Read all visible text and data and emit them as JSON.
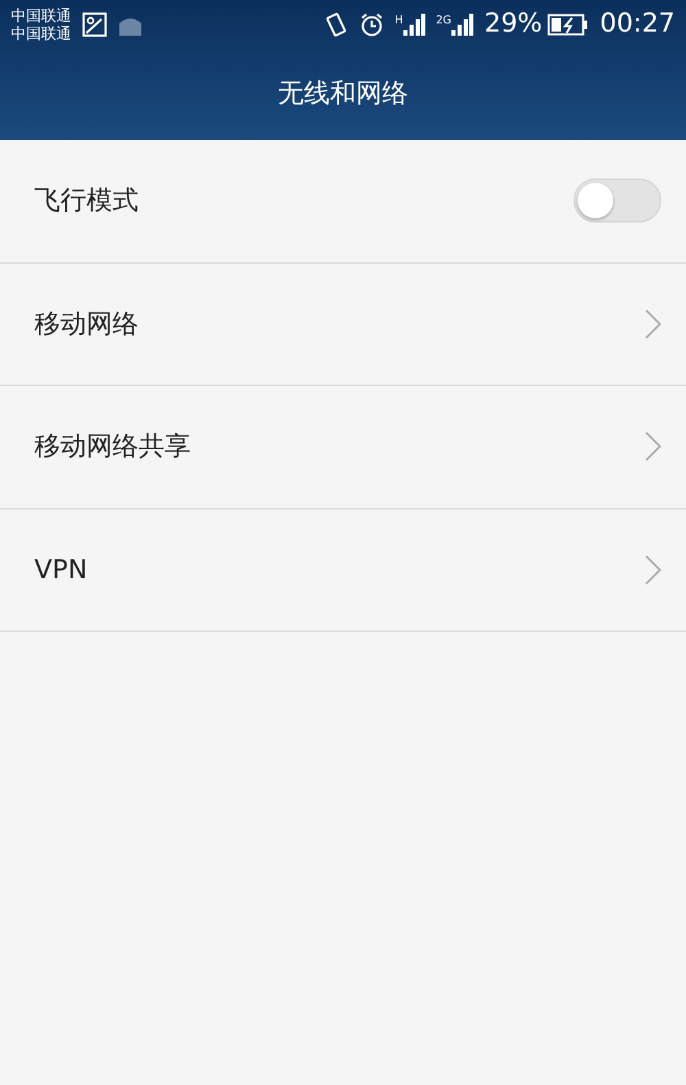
{
  "status_bar": {
    "carriers": [
      "中国联通",
      "中国联通"
    ],
    "networks": [
      {
        "type": "H"
      },
      {
        "type": "2G"
      }
    ],
    "battery": "29%",
    "time": "00:27"
  },
  "title": "无线和网络",
  "items": [
    {
      "kind": "toggle",
      "label": "飞行模式",
      "on": false
    },
    {
      "kind": "link",
      "label": "移动网络"
    },
    {
      "kind": "link",
      "label": "移动网络共享"
    },
    {
      "kind": "link",
      "label": "VPN"
    }
  ]
}
